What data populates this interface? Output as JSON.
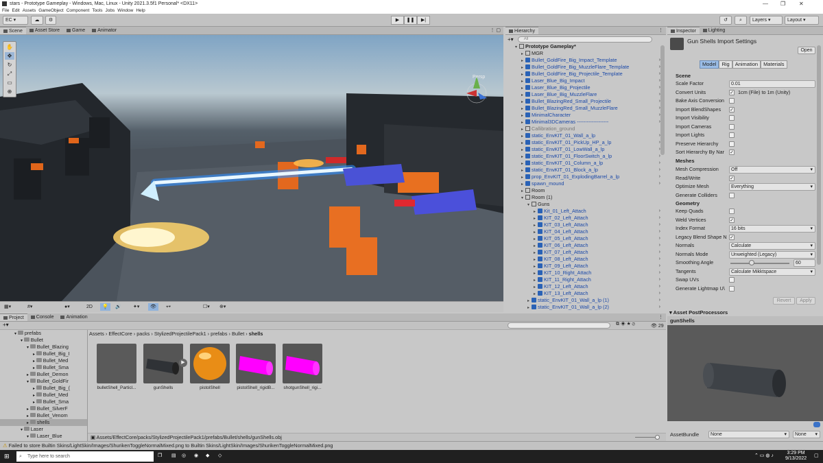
{
  "window": {
    "title": "stars - Prototype Gameplay - Windows, Mac, Linux - Unity 2021.3.5f1 Personal* <DX11>"
  },
  "menu": [
    "File",
    "Edit",
    "Assets",
    "GameObject",
    "Component",
    "Tools",
    "Jobs",
    "Window",
    "Help"
  ],
  "toolbar": {
    "account": "EC",
    "layers": "Layers",
    "layout": "Layout"
  },
  "scene_tabs": [
    "Scene",
    "Asset Store",
    "Game",
    "Animator"
  ],
  "scene": {
    "persp_label": "Persp",
    "btn_2d": "2D"
  },
  "hierarchy": {
    "tab": "Hierarchy",
    "search_placeholder": "All",
    "rows": [
      {
        "indent": 0,
        "text": "Prototype Gameplay*",
        "bold": true,
        "expanded": true
      },
      {
        "indent": 1,
        "text": "MGR",
        "kind": "go"
      },
      {
        "indent": 1,
        "text": "Bullet_GoldFire_Big_Impact_Template",
        "kind": "prefab"
      },
      {
        "indent": 1,
        "text": "Bullet_GoldFire_Big_MuzzleFlare_Template",
        "kind": "prefab"
      },
      {
        "indent": 1,
        "text": "Bullet_GoldFire_Big_Projectile_Template",
        "kind": "prefab"
      },
      {
        "indent": 1,
        "text": "Laser_Blue_Big_Impact",
        "kind": "prefab"
      },
      {
        "indent": 1,
        "text": "Laser_Blue_Big_Projectile",
        "kind": "prefab"
      },
      {
        "indent": 1,
        "text": "Laser_Blue_Big_MuzzleFlare",
        "kind": "prefab"
      },
      {
        "indent": 1,
        "text": "Bullet_BlazingRed_Small_Projectile",
        "kind": "prefab"
      },
      {
        "indent": 1,
        "text": "Bullet_BlazingRed_Small_MuzzleFlare",
        "kind": "prefab"
      },
      {
        "indent": 1,
        "text": "MinimalCharacter",
        "kind": "prefab"
      },
      {
        "indent": 1,
        "text": "Minimal3DCameras",
        "kind": "prefab",
        "dashed": true
      },
      {
        "indent": 1,
        "text": "Callibration_ground",
        "kind": "grey"
      },
      {
        "indent": 1,
        "text": "static_EnvKIT_01_Wall_a_lp",
        "kind": "prefab"
      },
      {
        "indent": 1,
        "text": "static_EnvKIT_01_PickUp_HP_a_lp",
        "kind": "prefab"
      },
      {
        "indent": 1,
        "text": "static_EnvKIT_01_LowWall_a_lp",
        "kind": "prefab"
      },
      {
        "indent": 1,
        "text": "static_EnvKIT_01_FloorSwitch_a_lp",
        "kind": "prefab"
      },
      {
        "indent": 1,
        "text": "static_EnvKIT_01_Column_a_lp",
        "kind": "prefab"
      },
      {
        "indent": 1,
        "text": "static_EnvKIT_01_Block_a_lp",
        "kind": "prefab"
      },
      {
        "indent": 1,
        "text": "prop_EnvKIT_01_ExplodingBarrel_a_lp",
        "kind": "prefab"
      },
      {
        "indent": 1,
        "text": "spawn_mound",
        "kind": "prefab"
      },
      {
        "indent": 1,
        "text": "Room",
        "kind": "go"
      },
      {
        "indent": 1,
        "text": "Room (1)",
        "kind": "go",
        "expanded": true
      },
      {
        "indent": 2,
        "text": "Guns",
        "kind": "go",
        "expanded": true
      },
      {
        "indent": 3,
        "text": "Kit_01_Left_Attach",
        "kind": "prefab"
      },
      {
        "indent": 3,
        "text": "KIT_02_Left_Attach",
        "kind": "prefab"
      },
      {
        "indent": 3,
        "text": "KIT_03_Left_Attach",
        "kind": "prefab"
      },
      {
        "indent": 3,
        "text": "KIT_04_Left_Attach",
        "kind": "prefab"
      },
      {
        "indent": 3,
        "text": "KIT_05_Left_Attach",
        "kind": "prefab"
      },
      {
        "indent": 3,
        "text": "KIT_06_Left_Attach",
        "kind": "prefab"
      },
      {
        "indent": 3,
        "text": "KIT_07_Left_Attach",
        "kind": "prefab"
      },
      {
        "indent": 3,
        "text": "KIT_08_Left_Attach",
        "kind": "prefab"
      },
      {
        "indent": 3,
        "text": "KIT_09_Left_Attach",
        "kind": "prefab"
      },
      {
        "indent": 3,
        "text": "KIT_10_Right_Attach",
        "kind": "prefab"
      },
      {
        "indent": 3,
        "text": "KIT_11_Right_Attach",
        "kind": "prefab"
      },
      {
        "indent": 3,
        "text": "KIT_12_Left_Attach",
        "kind": "prefab"
      },
      {
        "indent": 3,
        "text": "KIT_13_Left_Attach",
        "kind": "prefab"
      },
      {
        "indent": 2,
        "text": "static_EnvKIT_01_Wall_a_lp (1)",
        "kind": "prefab"
      },
      {
        "indent": 2,
        "text": "static_EnvKIT_01_Wall_a_lp (2)",
        "kind": "prefab"
      }
    ]
  },
  "inspector": {
    "tabs": [
      "Inspector",
      "Lighting"
    ],
    "title": "Gun Shells Import Settings",
    "open_btn": "Open",
    "subtabs": [
      "Model",
      "Rig",
      "Animation",
      "Materials"
    ],
    "scene_header": "Scene",
    "scale_factor_label": "Scale Factor",
    "scale_factor": "0.01",
    "convert_units_label": "Convert Units",
    "convert_units_text": "1cm (File) to 1m (Unity)",
    "bake_axis_label": "Bake Axis Conversion",
    "import_blendshapes_label": "Import BlendShapes",
    "import_visibility_label": "Import Visibility",
    "import_cameras_label": "Import Cameras",
    "import_lights_label": "Import Lights",
    "preserve_hierarchy_label": "Preserve Hierarchy",
    "sort_hierarchy_label": "Sort Hierarchy By Nar",
    "meshes_header": "Meshes",
    "mesh_compression_label": "Mesh Compression",
    "mesh_compression": "Off",
    "read_write_label": "Read/Write",
    "optimize_mesh_label": "Optimize Mesh",
    "optimize_mesh": "Everything",
    "generate_colliders_label": "Generate Colliders",
    "geometry_header": "Geometry",
    "keep_quads_label": "Keep Quads",
    "weld_vertices_label": "Weld Vertices",
    "index_format_label": "Index Format",
    "index_format": "16 bits",
    "legacy_blend_label": "Legacy Blend Shape N",
    "normals_label": "Normals",
    "normals": "Calculate",
    "normals_mode_label": "Normals Mode",
    "normals_mode": "Unweighted (Legacy)",
    "smoothing_angle_label": "Smoothing Angle",
    "smoothing_angle": "60",
    "tangents_label": "Tangents",
    "tangents": "Calculate Mikktspace",
    "swap_uvs_label": "Swap UVs",
    "generate_lightmap_label": "Generate Lightmap U\\",
    "revert_btn": "Revert",
    "apply_btn": "Apply",
    "postprocessors_header": "Asset PostProcessors",
    "preview_title": "gunShells",
    "assetbundle_label": "AssetBundle",
    "assetbundle_value": "None",
    "assetbundle_variant": "None"
  },
  "project": {
    "tabs": [
      "Project",
      "Console",
      "Animation"
    ],
    "breadcrumb": [
      "Assets",
      "EffectCore",
      "packs",
      "StylizedProjectilePack1",
      "prefabs",
      "Bullet",
      "shells"
    ],
    "count": "29",
    "tree": [
      {
        "indent": 3,
        "text": "prefabs",
        "open": true
      },
      {
        "indent": 4,
        "text": "Bullet",
        "open": true
      },
      {
        "indent": 5,
        "text": "Bullet_Blazing",
        "open": true
      },
      {
        "indent": 6,
        "text": "Bullet_Big_I"
      },
      {
        "indent": 6,
        "text": "Bullet_Med"
      },
      {
        "indent": 6,
        "text": "Bullet_Sma"
      },
      {
        "indent": 5,
        "text": "Bullet_Demon"
      },
      {
        "indent": 5,
        "text": "Bullet_GoldFir",
        "open": true
      },
      {
        "indent": 6,
        "text": "Bullet_Big_("
      },
      {
        "indent": 6,
        "text": "Bullet_Med"
      },
      {
        "indent": 6,
        "text": "Bullet_Sma"
      },
      {
        "indent": 5,
        "text": "Bullet_SilverF"
      },
      {
        "indent": 5,
        "text": "Bullet_Venom"
      },
      {
        "indent": 5,
        "text": "shells",
        "selected": true
      },
      {
        "indent": 4,
        "text": "Laser",
        "open": true
      },
      {
        "indent": 5,
        "text": "Laser_Blue",
        "open": true
      }
    ],
    "assets": [
      {
        "label": "bulletShell_Particl...",
        "kind": "dark"
      },
      {
        "label": "gunShells",
        "kind": "shell"
      },
      {
        "label": "pistolShell",
        "kind": "orange"
      },
      {
        "label": "pistolShell_rigidB...",
        "kind": "pink"
      },
      {
        "label": "shotgunShell_rigi...",
        "kind": "pink"
      }
    ],
    "path": "Assets/EffectCore/packs/StylizedProjectilePack1/prefabs/Bullet/shells/gunShells.obj"
  },
  "status": {
    "message": "Failed to store Builtin Skins/LightSkin/Images/ShurikenToggleNormalMixed.png to Builtin Skins/LightSkin/Images/ShurikenToggleNormalMixed.png"
  },
  "taskbar": {
    "search_placeholder": "Type here to search",
    "time": "3:29 PM",
    "date": "9/13/2022"
  },
  "colors": {
    "accent": "#2a62b6",
    "selected": "#3a72c8",
    "laser": "#35a8ff",
    "orange": "#f07a1c",
    "magenta": "#ff00ff"
  }
}
